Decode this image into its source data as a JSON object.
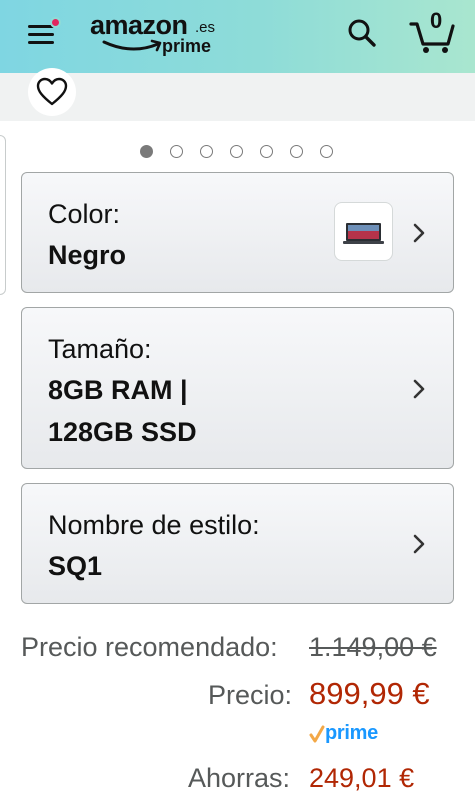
{
  "header": {
    "logo_word": "amazon",
    "logo_tld": ".es",
    "logo_sub": "prime",
    "cart_count": "0",
    "icons": [
      "menu-icon",
      "search-icon",
      "cart-icon"
    ],
    "notification_dot_color": "#e2265f"
  },
  "carousel": {
    "dot_count": 7,
    "active_index": 0
  },
  "options": [
    {
      "label": "Color:",
      "value": "Negro",
      "thumbnail": "surface-laptop-thumbnail"
    },
    {
      "label": "Tamaño:",
      "value_line1": "8GB RAM |",
      "value_line2": "128GB SSD"
    },
    {
      "label": "Nombre de estilo:",
      "value": "SQ1"
    }
  ],
  "pricing": {
    "list_label": "Precio recomendado:",
    "list_price": "1.149,00 €",
    "price_label": "Precio:",
    "price": "899,99 €",
    "prime_badge": "prime",
    "savings_label": "Ahorras:",
    "savings": "249,01 €",
    "price_color": "#b12704",
    "prime_color": "#1a98ff"
  }
}
